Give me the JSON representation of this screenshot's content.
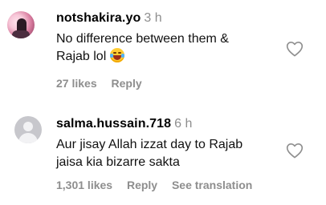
{
  "comments": [
    {
      "username": "notshakira.yo",
      "time": "3 h",
      "text_line1": "No difference between them &",
      "text_line2": "Rajab lol",
      "emoji": "laughing-tears-emoji",
      "likes": "27 likes",
      "reply": "Reply"
    },
    {
      "username": "salma.hussain.718",
      "time": "6 h",
      "text_line1": "Aur jisay Allah izzat day to Rajab",
      "text_line2": "jaisa kia bizarre sakta",
      "likes": "1,301 likes",
      "reply": "Reply",
      "translation": "See translation"
    }
  ],
  "icons": {
    "like": "heart-outline-icon",
    "avatar_default": "default-avatar-icon"
  },
  "colors": {
    "secondary_text": "#8e8e8e",
    "heart_stroke": "#8e8e8e"
  }
}
